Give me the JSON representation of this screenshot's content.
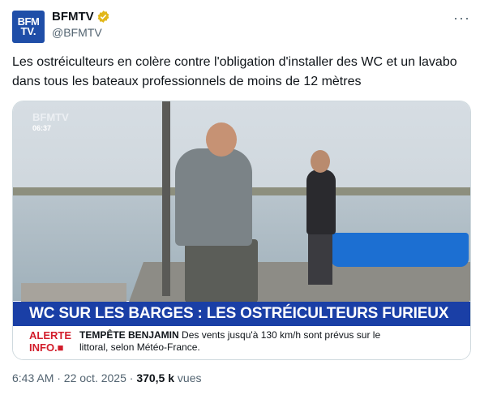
{
  "tweet": {
    "author_name": "BFMTV",
    "author_handle": "@BFMTV",
    "avatar_text_line1": "BFM",
    "avatar_text_line2": "TV.",
    "more_label": "···",
    "text": "Les ostréiculteurs en colère contre l'obligation d'installer des WC et un lavabo dans tous les bateaux professionnels de moins de 12 mètres",
    "timestamp": "6:43 AM · 22 oct. 2025 ·",
    "views_count": "370,5 k",
    "views_label": "vues"
  },
  "media": {
    "channel_logo": "BFMTV",
    "clock": "06:37",
    "banner": "WC SUR LES BARGES : LES OSTRÉICULTEURS FURIEUX",
    "alert_label_line1": "ALERTE",
    "alert_label_line2": "INFO.■",
    "alert_title": "TEMPÊTE BENJAMIN",
    "alert_text": "Des vents jusqu'à 130 km/h sont prévus sur le littoral, selon Météo-France."
  },
  "colors": {
    "avatar_bg": "#1f4ea8",
    "verified_badge": "#e2b719",
    "banner_bg": "#1a3fa6",
    "alert_red": "#d21d2b",
    "secondary_text": "#536471"
  }
}
